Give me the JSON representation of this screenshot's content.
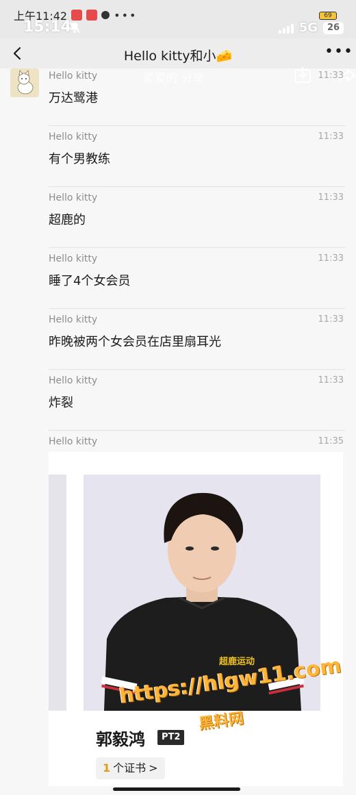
{
  "status": {
    "inner_time": "上午11:42",
    "outer_time": "15:14",
    "network": "5G",
    "battery": "26",
    "inner_battery": "69"
  },
  "header": {
    "title": "Hello kitty和小🧀"
  },
  "overlay": {
    "share_text": "累累的 分享"
  },
  "messages": [
    {
      "name": "Hello kitty",
      "time": "11:33",
      "text": "万达鹭港"
    },
    {
      "name": "Hello kitty",
      "time": "11:33",
      "text": "有个男教练"
    },
    {
      "name": "Hello kitty",
      "time": "11:33",
      "text": "超鹿的"
    },
    {
      "name": "Hello kitty",
      "time": "11:33",
      "text": "睡了4个女会员"
    },
    {
      "name": "Hello kitty",
      "time": "11:33",
      "text": "昨晚被两个女会员在店里扇耳光"
    },
    {
      "name": "Hello kitty",
      "time": "11:33",
      "text": "炸裂"
    },
    {
      "name": "Hello kitty",
      "time": "11:35",
      "text": ""
    }
  ],
  "profile_card": {
    "coach_name": "郭毅鸿",
    "badge": "PT2",
    "cert_count": "1",
    "cert_label": "个证书",
    "cert_chevron": ">",
    "shirt_logo": "超鹿运动"
  },
  "watermark": {
    "url": "https://hlgw11.com",
    "site": "黑料网"
  },
  "colors": {
    "background": "#f7f7f7",
    "header_bg": "#ededed",
    "meta_text": "#8c8c8c",
    "watermark": "#ffb53a"
  }
}
